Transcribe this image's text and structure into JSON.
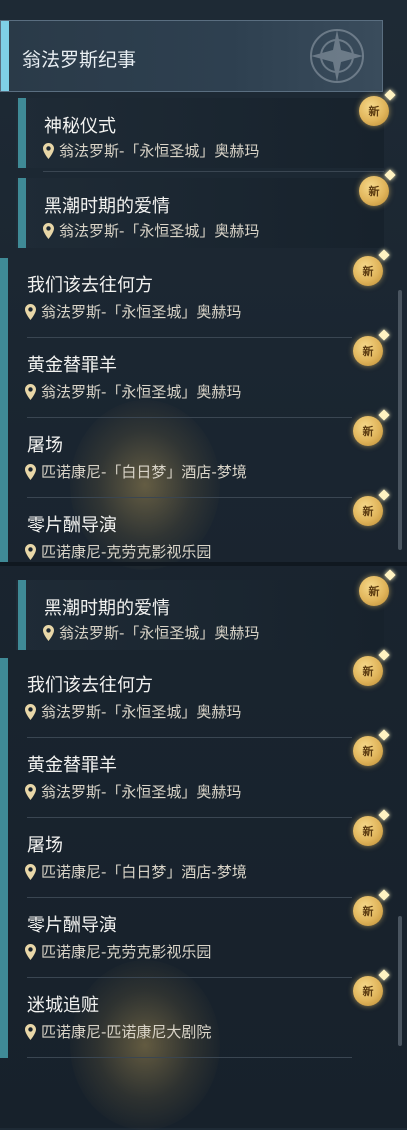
{
  "new_badge": "新",
  "header": {
    "title": "翁法罗斯纪事",
    "icon": "emblem-icon"
  },
  "top_panel": {
    "sub_items": [
      {
        "title": "神秘仪式",
        "location": "翁法罗斯-「永恒圣城」奥赫玛"
      },
      {
        "title": "黑潮时期的爱情",
        "location": "翁法罗斯-「永恒圣城」奥赫玛"
      }
    ],
    "items": [
      {
        "title": "我们该去往何方",
        "location": "翁法罗斯-「永恒圣城」奥赫玛"
      },
      {
        "title": "黄金替罪羊",
        "location": "翁法罗斯-「永恒圣城」奥赫玛"
      },
      {
        "title": "屠场",
        "location": "匹诺康尼-「白日梦」酒店-梦境"
      },
      {
        "title": "零片酬导演",
        "location": "匹诺康尼-克劳克影视乐园"
      }
    ]
  },
  "bottom_panel": {
    "sub_items": [
      {
        "title": "黑潮时期的爱情",
        "location": "翁法罗斯-「永恒圣城」奥赫玛"
      }
    ],
    "items": [
      {
        "title": "我们该去往何方",
        "location": "翁法罗斯-「永恒圣城」奥赫玛"
      },
      {
        "title": "黄金替罪羊",
        "location": "翁法罗斯-「永恒圣城」奥赫玛"
      },
      {
        "title": "屠场",
        "location": "匹诺康尼-「白日梦」酒店-梦境"
      },
      {
        "title": "零片酬导演",
        "location": "匹诺康尼-克劳克影视乐园"
      },
      {
        "title": "迷城追赃",
        "location": "匹诺康尼-匹诺康尼大剧院"
      }
    ]
  },
  "colors": {
    "accent_bar": "#3f8a96",
    "header_bar": "#7fd0e8",
    "badge_gold": "#e0b45a"
  }
}
